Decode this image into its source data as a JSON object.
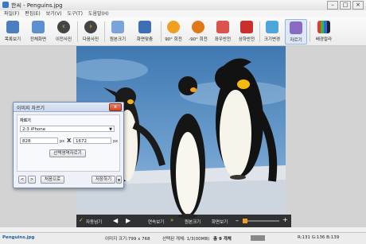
{
  "window": {
    "title": "한씨 - Penguins.jpg"
  },
  "menu": [
    "파일(F)",
    "편집(E)",
    "보기(V)",
    "도구(T)",
    "도움말(H)"
  ],
  "toolbar": [
    {
      "label": "목록보기",
      "icon": "list-icon"
    },
    {
      "label": "전체화면",
      "icon": "fullscreen-icon"
    },
    {
      "label": "이전사진",
      "icon": "arrow-left-icon"
    },
    {
      "label": "다음사진",
      "icon": "arrow-right-icon"
    },
    {
      "label": "원본크기",
      "icon": "original-size-icon"
    },
    {
      "label": "화면맞춤",
      "icon": "fit-screen-icon"
    },
    {
      "label": "90° 회전",
      "icon": "rotate-right-icon"
    },
    {
      "label": "-90° 회전",
      "icon": "rotate-left-icon"
    },
    {
      "label": "좌우반전",
      "icon": "flip-horizontal-icon"
    },
    {
      "label": "상하반전",
      "icon": "flip-vertical-icon"
    },
    {
      "label": "크기변경",
      "icon": "resize-icon"
    },
    {
      "label": "자르기",
      "icon": "crop-icon"
    },
    {
      "label": "배경칼라",
      "icon": "background-color-icon"
    }
  ],
  "dialog": {
    "title": "이미지 자르기",
    "close": "x",
    "section_label": "자르기",
    "ratio_value": "2:3 iPhone",
    "width_value": "828",
    "height_value": "1672",
    "unit": "px",
    "times": "X",
    "select_button": "선택영역자르기",
    "reset_button": "처음으로",
    "save_button": "저장하기",
    "prev_glyph": "<",
    "next_glyph": ">"
  },
  "thumbbar": {
    "autoplay": "자동넘기",
    "continuous": "연속보기",
    "original": "원본크기",
    "fit": "화면보기"
  },
  "status": {
    "filename": "Penguins.jpg",
    "image_size": "이미지 크기:799 x 768",
    "selection": "선택된 개체: 1/3(00MB)",
    "total": "총 9 개체",
    "rgb": "R:131 G:136 B:139"
  },
  "colors": {
    "accent": "#3a78c8",
    "sky": "#4b82b8",
    "ice": "#e3e7ec",
    "dialog_border": "#6f88ad",
    "close_red": "#c8452a"
  }
}
